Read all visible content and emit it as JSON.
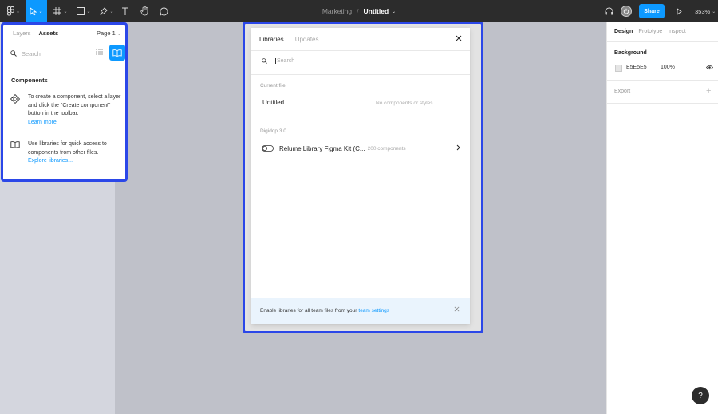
{
  "toolbar": {
    "project": "Marketing",
    "separator": "/",
    "file": "Untitled",
    "share_label": "Share",
    "zoom": "353%",
    "colors": {
      "bar": "#2c2c2c",
      "accent": "#0d99ff"
    }
  },
  "left_panel": {
    "tabs": [
      "Layers",
      "Assets"
    ],
    "page_label": "Page 1",
    "search_placeholder": "Search",
    "components_title": "Components",
    "create_component_text": "To create a component, select a layer and click the \"Create component\" button in the toolbar.",
    "learn_more": "Learn more",
    "libraries_text": "Use libraries for quick access to components from other files.",
    "explore_libraries": "Explore libraries..."
  },
  "right_panel": {
    "tabs": [
      "Design",
      "Prototype",
      "Inspect"
    ],
    "background_title": "Background",
    "background_hex": "E5E5E5",
    "background_opacity": "100%",
    "export_title": "Export"
  },
  "modal": {
    "tabs": [
      "Libraries",
      "Updates"
    ],
    "search_placeholder": "Search",
    "current_file_label": "Current file",
    "current_file_name": "Untitled",
    "current_file_meta": "No components or styles",
    "team_label": "Digidop 3.0",
    "library_name": "Relume Library Figma Kit (C...",
    "library_meta": "200 components",
    "footer_text": "Enable libraries for all team files from your",
    "footer_link": "team settings"
  },
  "help_label": "?"
}
